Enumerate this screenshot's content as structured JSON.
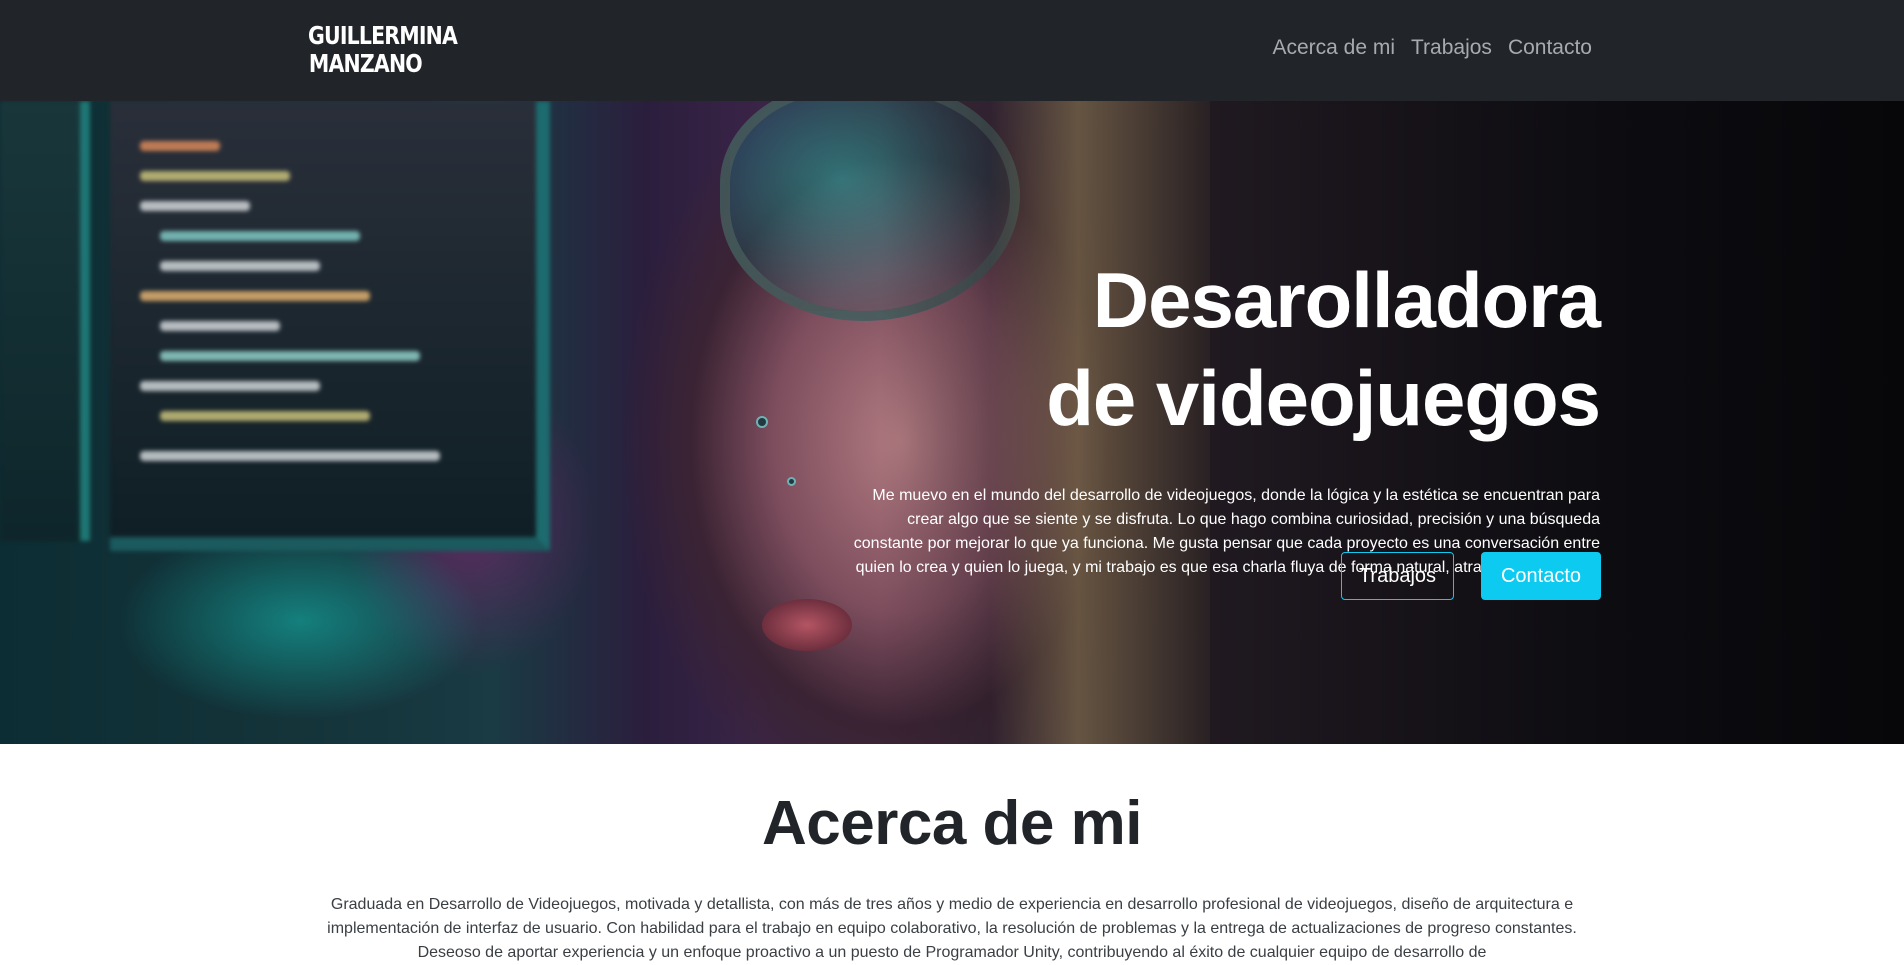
{
  "navbar": {
    "logo_line1": "GUILLERMINA",
    "logo_line2": "MANZANO",
    "links": [
      "Acerca de mi",
      "Trabajos",
      "Contacto"
    ]
  },
  "hero": {
    "title_line1": "Desarolladora",
    "title_line2": "de videojuegos",
    "description": "Me muevo en el mundo del desarrollo de videojuegos, donde la lógica y la estética se encuentran para crear algo que se siente y se disfruta. Lo que hago combina curiosidad, precisión y una búsqueda constante por mejorar lo que ya funciona. Me gusta pensar que cada proyecto es una conversación entre quien lo crea y quien lo juega, y mi trabajo es que esa charla fluya de forma natural, atractiva y dinámica.",
    "button_secondary": "Trabajos",
    "button_primary": "Contacto"
  },
  "about": {
    "title": "Acerca de mi",
    "text": "Graduada en Desarrollo de Videojuegos, motivada y detallista, con más de tres años y medio de experiencia en desarrollo profesional de videojuegos, diseño de arquitectura e implementación de interfaz de usuario. Con habilidad para el trabajo en equipo colaborativo, la resolución de problemas y la entrega de actualizaciones de progreso constantes. Deseoso de aportar experiencia y un enfoque proactivo a un puesto de Programador Unity, contribuyendo al éxito de cualquier equipo de desarrollo de"
  },
  "colors": {
    "navbar_bg": "#212529",
    "accent": "#0dcaf0",
    "nav_link": "#a7abb0"
  }
}
